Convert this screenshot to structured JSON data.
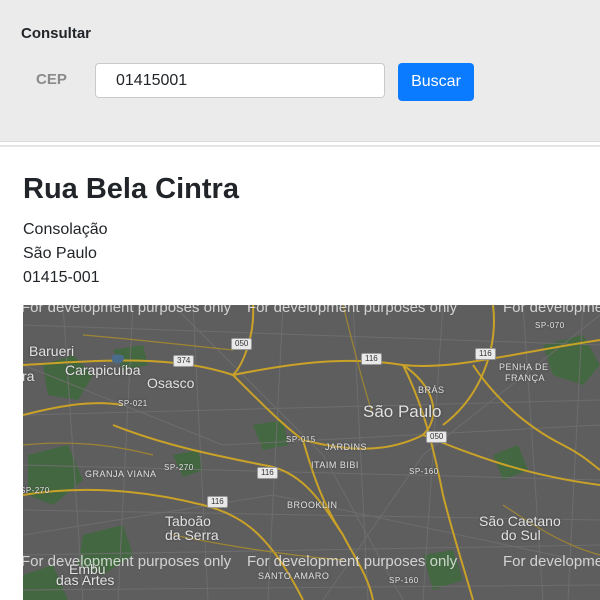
{
  "form": {
    "title": "Consultar",
    "cep_label": "CEP",
    "cep_value": "01415001",
    "search_button": "Buscar"
  },
  "result": {
    "street": "Rua Bela Cintra",
    "neighborhood": "Consolação",
    "city": "São Paulo",
    "cep": "01415-001"
  },
  "map": {
    "watermark": "For development purposes only",
    "labels": {
      "barueri": "Barueri",
      "carapicuiba": "Carapicuíba",
      "osasco": "Osasco",
      "sao_paulo": "São Paulo",
      "bras": "BRÁS",
      "penha": "PENHA DE",
      "franca": "FRANÇA",
      "jardins": "JARDINS",
      "itaim_bibi": "ITAIM BIBI",
      "granja_viana": "GRANJA VIANA",
      "brooklin": "BROOKLIN",
      "taboao1": "Taboão",
      "taboao2": "da Serra",
      "sao_caetano1": "São Caetano",
      "sao_caetano2": "do Sul",
      "santo_amaro": "SANTO AMARO",
      "embu1": "Embu",
      "embu2": "das Artes",
      "ra": "ra"
    },
    "roads": {
      "r050a": "050",
      "r374": "374",
      "r116a": "116",
      "r116b": "116",
      "sp070": "SP-070",
      "sp021": "SP-021",
      "sp015": "SP-015",
      "r050b": "050",
      "sp270a": "SP-270",
      "r116c": "116",
      "sp160a": "SP-160",
      "sp270b": "SP-270",
      "r116d": "116",
      "sp160b": "SP-160"
    }
  }
}
